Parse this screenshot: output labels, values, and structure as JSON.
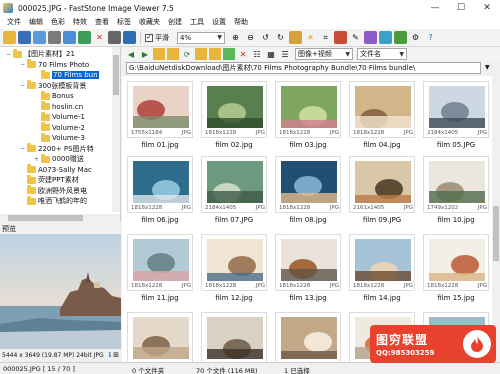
{
  "window": {
    "title": "000025.JPG  -  FastStone Image Viewer 7.5",
    "minimize": "—",
    "maximize": "☐",
    "close": "✕"
  },
  "menu": [
    "文件",
    "编辑",
    "色彩",
    "特效",
    "查看",
    "标签",
    "收藏夹",
    "创建",
    "工具",
    "设置",
    "帮助"
  ],
  "toolbar": {
    "fit_checkbox_label": "平滑",
    "fit_checked": true,
    "zoom_value": "4%",
    "view_mode": "图像+视频",
    "sort_by": "文件名"
  },
  "path": "G:\\BaiduNetdiskDownload\\图片素材\\70 Films Photography Bundle\\70 Films bundle\\",
  "tree": [
    {
      "label": "【图片素材】21",
      "indent": 1,
      "expander": "−",
      "selected": false
    },
    {
      "label": "70 Films Photo",
      "indent": 2,
      "expander": "−",
      "selected": false
    },
    {
      "label": "70 Films bun",
      "indent": 3,
      "expander": "",
      "selected": true
    },
    {
      "label": "300张模板背景",
      "indent": 2,
      "expander": "−",
      "selected": false
    },
    {
      "label": "Bonus",
      "indent": 3,
      "expander": "",
      "selected": false
    },
    {
      "label": "hoslin.cn",
      "indent": 3,
      "expander": "",
      "selected": false
    },
    {
      "label": "Volume-1",
      "indent": 3,
      "expander": "",
      "selected": false
    },
    {
      "label": "Volume-2",
      "indent": 3,
      "expander": "",
      "selected": false
    },
    {
      "label": "Volume-3",
      "indent": 3,
      "expander": "",
      "selected": false
    },
    {
      "label": "2200+ PS图片特",
      "indent": 2,
      "expander": "−",
      "selected": false
    },
    {
      "label": "0000赠送",
      "indent": 3,
      "expander": "+",
      "selected": false
    },
    {
      "label": "A073-Sally Mac",
      "indent": 2,
      "expander": "",
      "selected": false
    },
    {
      "label": "荧建PPT素材",
      "indent": 2,
      "expander": "",
      "selected": false
    },
    {
      "label": "欧洲野外风景电",
      "indent": 2,
      "expander": "",
      "selected": false
    },
    {
      "label": "唯洒飞鹤的年的",
      "indent": 2,
      "expander": "",
      "selected": false
    }
  ],
  "preview": {
    "header": "预览",
    "info": "5444 x 3649 (19.87 MP)  24bit  JPG"
  },
  "thumbnails": [
    {
      "name": "film 01.jpg",
      "dims": "1755x1184",
      "type": "JPG",
      "selected": false
    },
    {
      "name": "film 02.jpg",
      "dims": "1818x1228",
      "type": "JPG",
      "selected": false
    },
    {
      "name": "film 03.jpg",
      "dims": "1818x1228",
      "type": "JPG",
      "selected": false
    },
    {
      "name": "film 04.jpg",
      "dims": "1818x1228",
      "type": "JPG",
      "selected": false
    },
    {
      "name": "film 05.JPG",
      "dims": "2184x1405",
      "type": "JPG",
      "selected": false
    },
    {
      "name": "film 06.jpg",
      "dims": "1818x1228",
      "type": "JPG",
      "selected": false
    },
    {
      "name": "film 07.JPG",
      "dims": "2184x1405",
      "type": "JPG",
      "selected": false
    },
    {
      "name": "film 08.jpg",
      "dims": "1818x1228",
      "type": "JPG",
      "selected": false
    },
    {
      "name": "film 09.JPG",
      "dims": "2161x1405",
      "type": "JPG",
      "selected": false
    },
    {
      "name": "film 10.jpg",
      "dims": "1749x1202",
      "type": "JPG",
      "selected": false
    },
    {
      "name": "film 11.jpg",
      "dims": "1818x1228",
      "type": "JPG",
      "selected": false
    },
    {
      "name": "film 12.jpg",
      "dims": "1818x1228",
      "type": "JPG",
      "selected": false
    },
    {
      "name": "film 13.jpg",
      "dims": "1818x1228",
      "type": "JPG",
      "selected": false
    },
    {
      "name": "film 14.jpg",
      "dims": "1818x1228",
      "type": "JPG",
      "selected": false
    },
    {
      "name": "film 15.jpg",
      "dims": "1818x1228",
      "type": "JPG",
      "selected": false
    },
    {
      "name": "",
      "dims": "",
      "type": "",
      "selected": false
    },
    {
      "name": "",
      "dims": "",
      "type": "",
      "selected": false
    },
    {
      "name": "",
      "dims": "",
      "type": "",
      "selected": false
    },
    {
      "name": "",
      "dims": "",
      "type": "",
      "selected": false
    },
    {
      "name": "",
      "dims": "",
      "type": "",
      "selected": false
    }
  ],
  "status": {
    "file": "000025.JPG [ 15 / 70 ]",
    "folders": "0 个文件夹",
    "files": "70 个文件 (116 MB)",
    "selected": "1 已选择"
  },
  "watermark": {
    "title": "图穷联盟",
    "qq": "QQ:985303259"
  }
}
